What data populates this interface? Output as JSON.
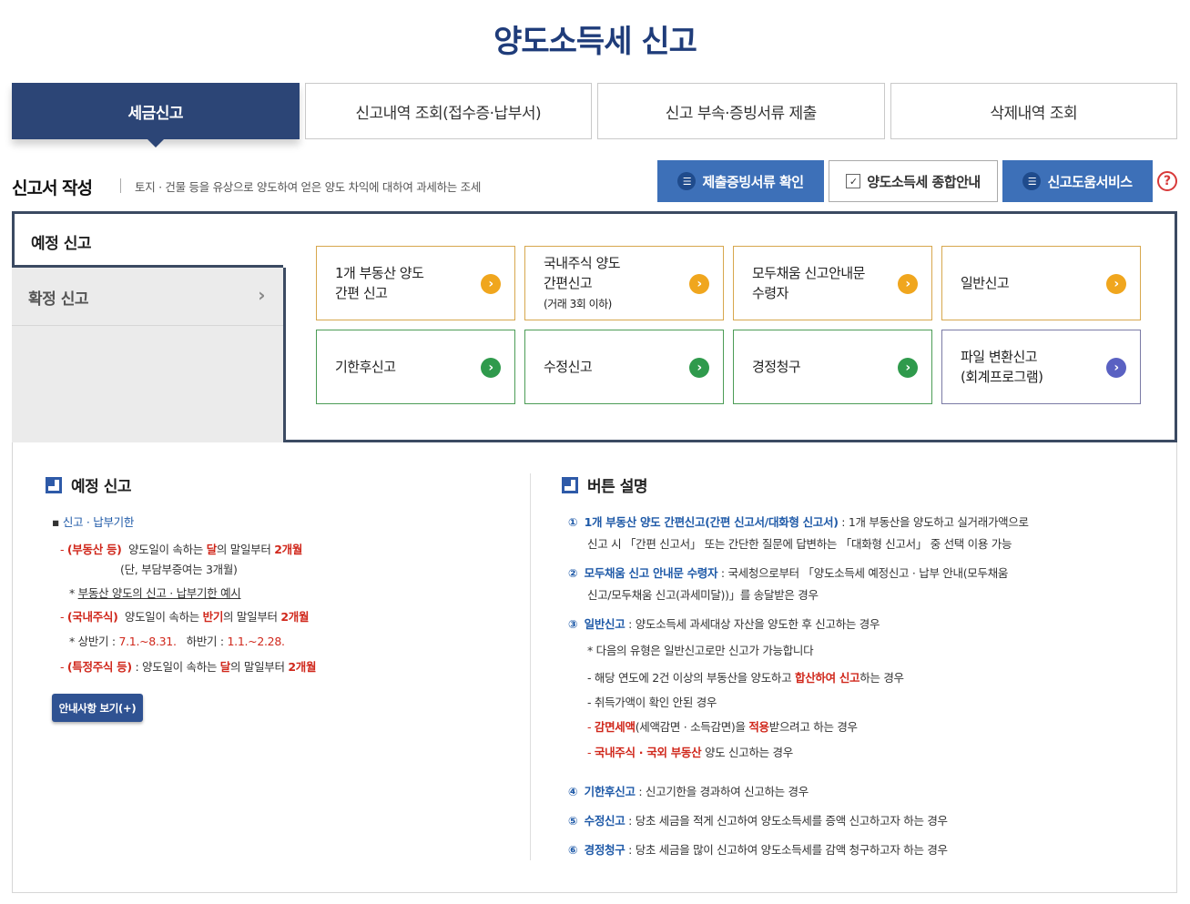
{
  "title": "양도소득세 신고",
  "tabs": [
    "세금신고",
    "신고내역 조회(접수증·납부서)",
    "신고 부속·증빙서류 제출",
    "삭제내역 조회"
  ],
  "subheader": {
    "title": "신고서 작성",
    "description": "토지 · 건물 등을 유상으로 양도하여 얻은 양도 차익에 대하여 과세하는 조세",
    "buttons": [
      "제출증빙서류 확인",
      "양도소득세 종합안내",
      "신고도움서비스"
    ],
    "help": "?"
  },
  "sidebar": {
    "active": "예정 신고",
    "items": [
      "확정 신고"
    ]
  },
  "report_buttons": [
    {
      "l1": "1개 부동산 양도",
      "l2": "간편 신고",
      "l3": ""
    },
    {
      "l1": "국내주식 양도",
      "l2": "간편신고",
      "l3": "(거래 3회 이하)"
    },
    {
      "l1": "모두채움 신고안내문",
      "l2": "수령자",
      "l3": ""
    },
    {
      "l1": "일반신고",
      "l2": "",
      "l3": ""
    },
    {
      "l1": "기한후신고",
      "l2": "",
      "l3": ""
    },
    {
      "l1": "수정신고",
      "l2": "",
      "l3": ""
    },
    {
      "l1": "경정청구",
      "l2": "",
      "l3": ""
    },
    {
      "l1": "파일 변환신고",
      "l2": "(회계프로그램)",
      "l3": ""
    }
  ],
  "left_info": {
    "heading": "예정 신고",
    "deadline_label": "신고 · 납부기한",
    "realestate_tag": "(부동산  등)",
    "realestate_a": "양도일이 속하는 ",
    "realestate_b": "달",
    "realestate_c": "의 말일부터 ",
    "realestate_d": "2개월",
    "realestate_note": "(단, 부담부증여는 3개월)",
    "example": "부동산 양도의 신고 · 납부기한 예시",
    "stock_tag": "(국내주식)",
    "stock_a": "양도일이 속하는 ",
    "stock_b": "반기",
    "stock_c": "의 말일부터 ",
    "stock_d": "2개월",
    "half_first_label": "상반기 : ",
    "half_first": "7.1.~8.31.",
    "half_second_label": "하반기 : ",
    "half_second": "1.1.~2.28.",
    "special_tag": "(특정주식 등)",
    "special_a": " : 양도일이 속하는 ",
    "special_b": "달",
    "special_c": "의 말일부터 ",
    "special_d": "2개월",
    "guide_button": "안내사항 보기(+)"
  },
  "right_info": {
    "heading": "버튼 설명",
    "i1_num": "①",
    "i1_title": "1개 부동산 양도 간편신고(간편 신고서/대화형 신고서)",
    "i1_text": " : 1개 부동산을 양도하고 실거래가액으로",
    "i1_text2": "신고 시 「간편 신고서」 또는 간단한 질문에 답변하는 「대화형 신고서」 중 선택 이용 가능",
    "i2_num": "②",
    "i2_title": "모두채움 신고 안내문 수령자",
    "i2_text": " : 국세청으로부터 「양도소득세 예정신고 · 납부 안내(모두채움",
    "i2_text2": "신고/모두채움 신고(과세미달))」를 송달받은 경우",
    "i3_num": "③",
    "i3_title": "일반신고",
    "i3_text": " : 양도소득세 과세대상 자산을 양도한 후 신고하는 경우",
    "i3_note": "* 다음의 유형은 일반신고로만 신고가 가능합니다",
    "i3_s1a": "해당 연도에 2건 이상의 부동산을 양도하고 ",
    "i3_s1b": "합산하여 신고",
    "i3_s1c": "하는 경우",
    "i3_s2": "취득가액이 확인 안된 경우",
    "i3_s3a": "감면세액",
    "i3_s3b": "(세액감면 · 소득감면)을 ",
    "i3_s3c": "적용",
    "i3_s3d": "받으려고 하는 경우",
    "i3_s4a": "국내주식 · 국외 부동산",
    "i3_s4b": " 양도 신고하는 경우",
    "i4_num": "④",
    "i4_title": "기한후신고",
    "i4_text": " : 신고기한을 경과하여 신고하는 경우",
    "i5_num": "⑤",
    "i5_title": "수정신고",
    "i5_text": " : 당초 세금을 적게 신고하여 양도소득세를 증액 신고하고자 하는 경우",
    "i6_num": "⑥",
    "i6_title": "경정청구",
    "i6_text": " : 당초 세금을 많이 신고하여 양도소득세를 감액 청구하고자 하는 경우"
  },
  "colors": {
    "title": "#1f3c7a",
    "active_tab": "#2c4576",
    "blue_button": "#3d70b8",
    "accent_red": "#d0281c",
    "accent_blue": "#1f5aa8"
  }
}
